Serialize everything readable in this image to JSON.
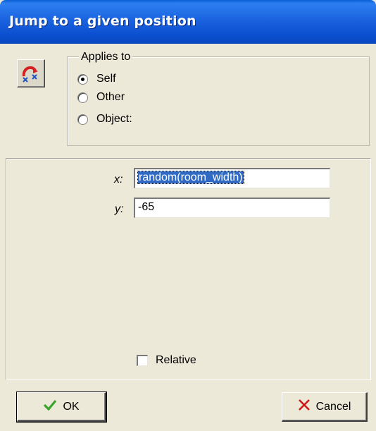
{
  "window": {
    "title": "Jump to a given position"
  },
  "applies_to": {
    "label": "Applies to",
    "options": [
      {
        "label": "Self",
        "checked": true
      },
      {
        "label": "Other",
        "checked": false
      },
      {
        "label": "Object:",
        "checked": false
      }
    ]
  },
  "params": {
    "x": {
      "label": "x:",
      "value": "random(room_width)"
    },
    "y": {
      "label": "y:",
      "value": "-65"
    },
    "relative": {
      "label": "Relative",
      "checked": false
    }
  },
  "buttons": {
    "ok": "OK",
    "cancel": "Cancel"
  },
  "icons": {
    "action": "jump-position-icon",
    "ok": "check-icon",
    "cancel": "x-icon"
  },
  "colors": {
    "titlebar": "#0b56d0",
    "selection": "#316ac5",
    "ok_check": "#3aa42a",
    "cancel_x": "#cc1a1a"
  }
}
